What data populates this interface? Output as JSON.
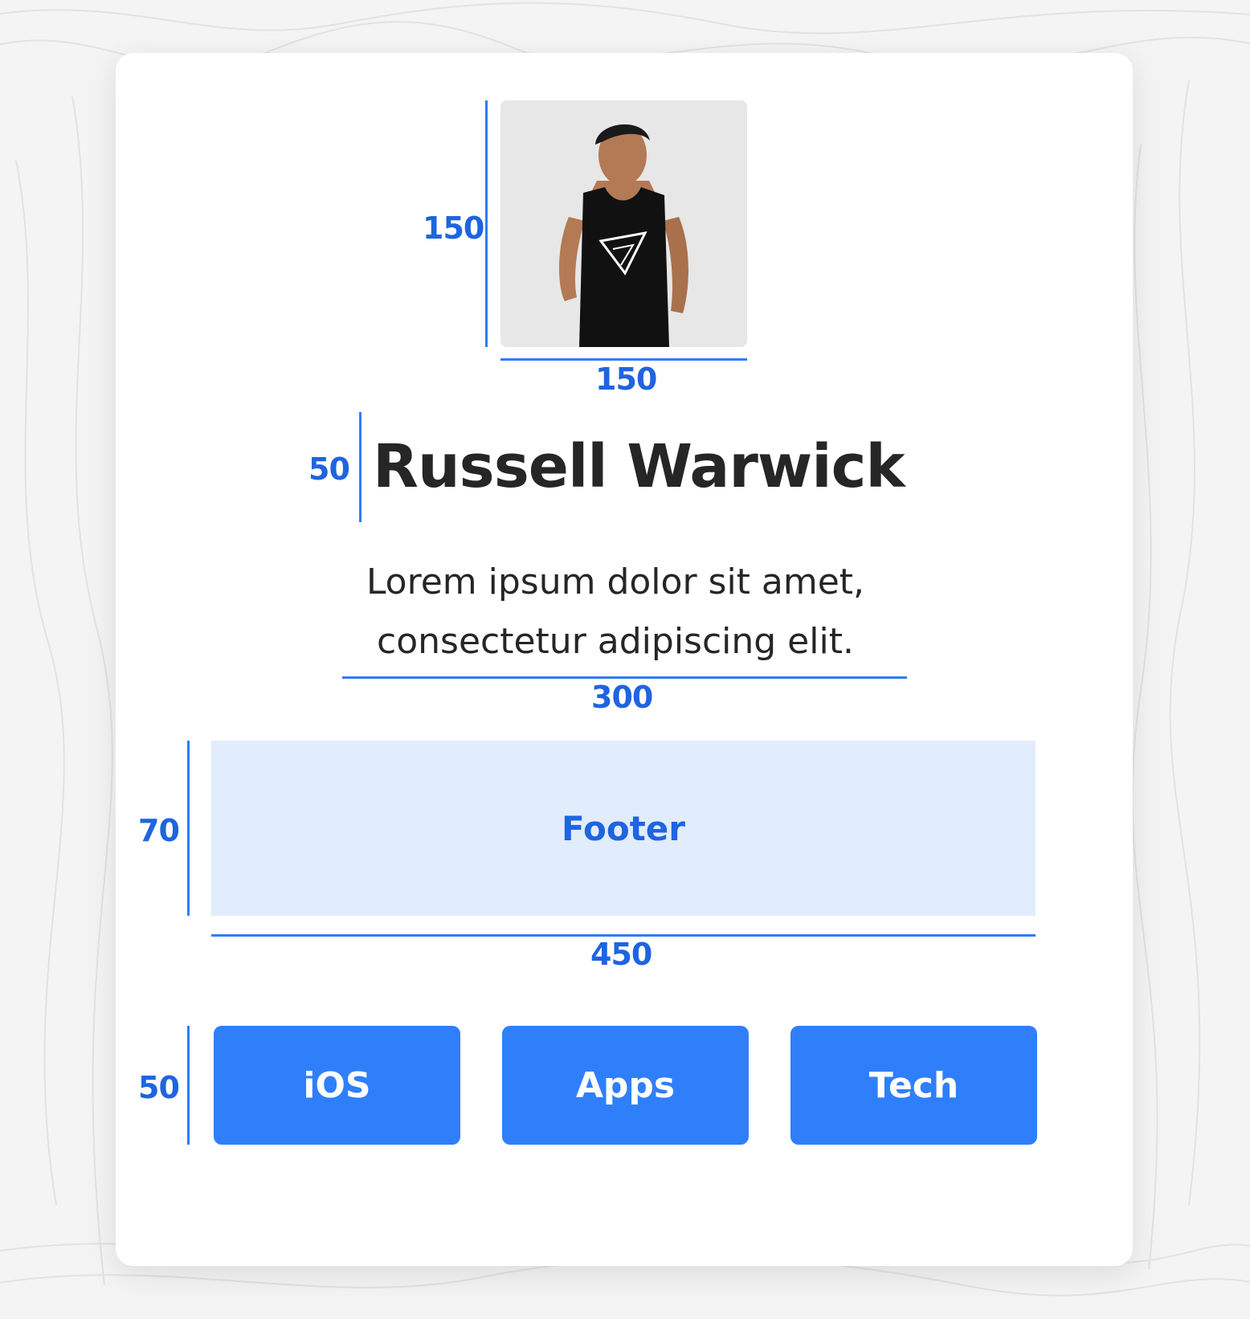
{
  "profile": {
    "name": "Russell Warwick",
    "description_line1": "Lorem ipsum dolor sit amet,",
    "description_line2": "consectetur adipiscing elit."
  },
  "dimensions": {
    "photo_height": "150",
    "photo_width": "150",
    "name_height": "50",
    "description_width": "300",
    "footer_height": "70",
    "footer_width": "450",
    "buttons_height": "50"
  },
  "footer": {
    "label": "Footer"
  },
  "tags": [
    {
      "label": "iOS"
    },
    {
      "label": "Apps"
    },
    {
      "label": "Tech"
    }
  ],
  "colors": {
    "accent": "#2f7ffb",
    "dimension_text": "#1f64e0",
    "footer_bg": "#e1ecfd",
    "text": "#262626"
  }
}
